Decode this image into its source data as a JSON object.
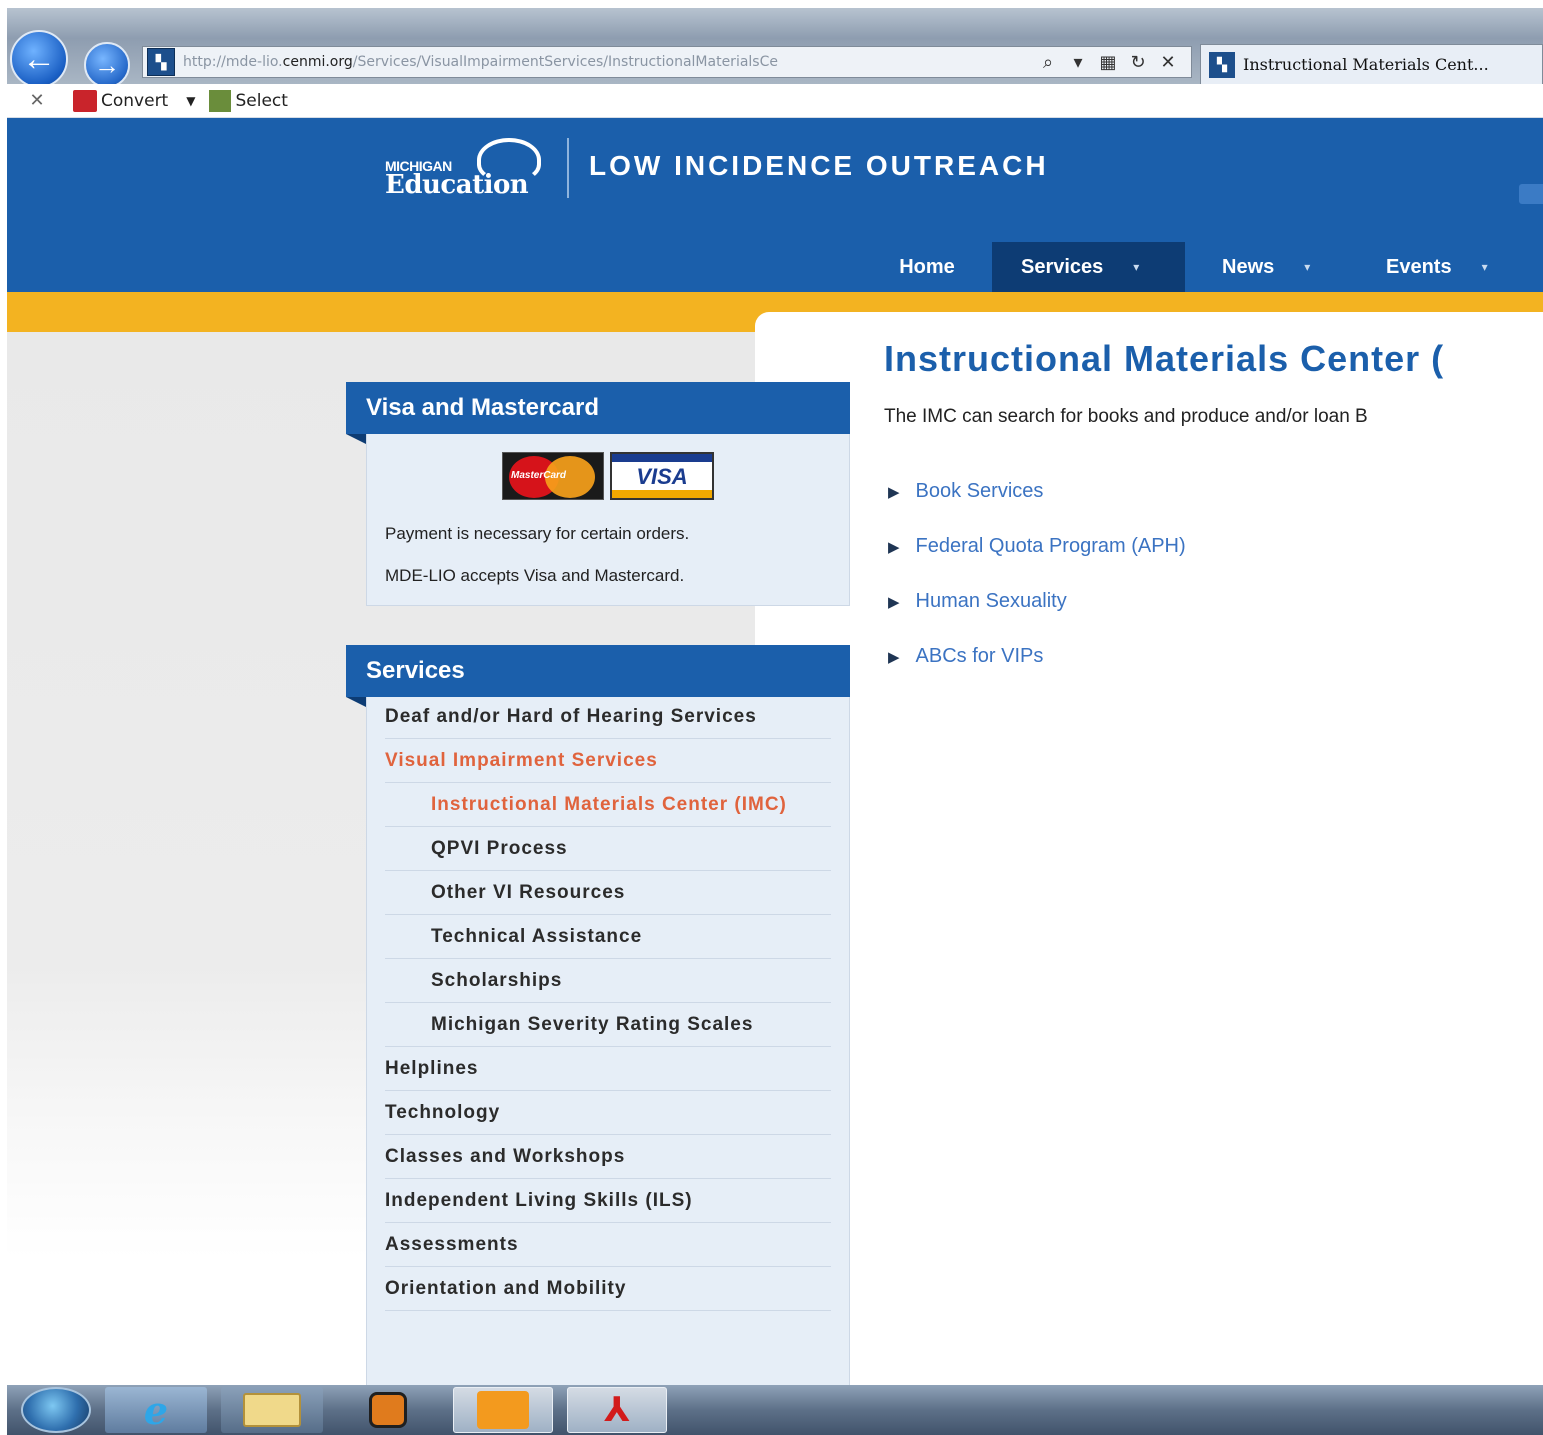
{
  "browser": {
    "url_prefix": "http://mde-lio.",
    "url_domain": "cenmi.org",
    "url_path": "/Services/VisualImpairmentServices/InstructionalMaterialsCe",
    "tab_title": "Instructional Materials Cent...",
    "back_glyph": "←",
    "forward_glyph": "→",
    "search_glyph": "⌕",
    "dropdown_glyph": "▾",
    "compat_glyph": "▦",
    "refresh_glyph": "↻",
    "stop_glyph": "✕",
    "favicon_glyph": "▚",
    "command_bar": {
      "close_glyph": "✕",
      "convert_label": "Convert",
      "convert_caret": "▼",
      "select_label": "Select"
    }
  },
  "header": {
    "logo_michigan": "MICHIGAN",
    "logo_education": "Education",
    "site_title": "LOW INCIDENCE OUTREACH",
    "nav": [
      {
        "label": "Home"
      },
      {
        "label": "Services",
        "caret": "▾"
      },
      {
        "label": "News",
        "caret": "▾"
      },
      {
        "label": "Events",
        "caret": "▾"
      }
    ]
  },
  "visa_panel": {
    "title": "Visa and Mastercard",
    "mastercard_text": "MasterCard",
    "visa_text": "VISA",
    "line1": "Payment is necessary for certain orders.",
    "line2": "MDE-LIO accepts Visa and Mastercard."
  },
  "services_panel": {
    "title": "Services",
    "items": [
      {
        "label": "Deaf and/or Hard of Hearing Services"
      },
      {
        "label": "Visual Impairment Services"
      },
      {
        "label": "Instructional Materials Center (IMC)"
      },
      {
        "label": "QPVI Process"
      },
      {
        "label": "Other VI Resources"
      },
      {
        "label": "Technical Assistance"
      },
      {
        "label": "Scholarships"
      },
      {
        "label": "Michigan Severity Rating Scales"
      },
      {
        "label": "Helplines"
      },
      {
        "label": "Technology"
      },
      {
        "label": "Classes and Workshops"
      },
      {
        "label": "Independent Living Skills (ILS)"
      },
      {
        "label": "Assessments"
      },
      {
        "label": "Orientation and Mobility"
      }
    ]
  },
  "content": {
    "heading": "Instructional Materials Center (",
    "intro": "The IMC can search for books and produce and/or loan B",
    "bullet_glyph": "▶",
    "links": [
      {
        "label": "Book Services"
      },
      {
        "label": "Federal Quota Program (APH)"
      },
      {
        "label": "Human Sexuality"
      },
      {
        "label": "ABCs for VIPs"
      }
    ]
  },
  "taskbar": {
    "ie_glyph": "e",
    "acrobat_glyph": "⅄"
  },
  "colors": {
    "brand_blue": "#1b5fab",
    "nav_active": "#0d3c74",
    "gold": "#f3b321",
    "current_link": "#e0633d",
    "link_blue": "#3b73c2"
  }
}
